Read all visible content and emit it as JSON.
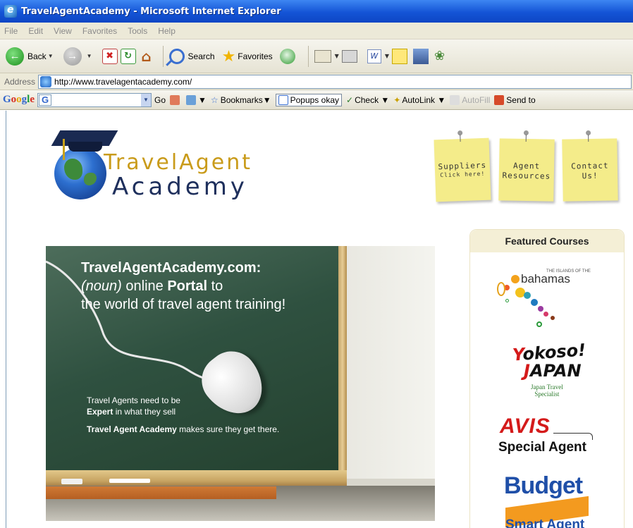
{
  "window": {
    "title": "TravelAgentAcademy - Microsoft Internet Explorer"
  },
  "menu": [
    "File",
    "Edit",
    "View",
    "Favorites",
    "Tools",
    "Help"
  ],
  "toolbar": {
    "back_label": "Back",
    "search_label": "Search",
    "favorites_label": "Favorites"
  },
  "address": {
    "label": "Address",
    "url": "http://www.travelagentacademy.com/"
  },
  "google_toolbar": {
    "logo": "Google",
    "go_label": "Go",
    "bookmarks_label": "Bookmarks",
    "popups_label": "Popups okay",
    "check_label": "Check",
    "autolink_label": "AutoLink",
    "autofill_label": "AutoFill",
    "sendto_label": "Send to"
  },
  "logo": {
    "line1": "TravelAgent",
    "line2": "Academy"
  },
  "notes": [
    {
      "line1": "Suppliers",
      "line2": "Click here!"
    },
    {
      "line1": "Agent",
      "line2": "Resources"
    },
    {
      "line1": "Contact",
      "line2": "Us!"
    }
  ],
  "hero": {
    "title": "TravelAgentAcademy.com:",
    "line2_noun": "(noun)",
    "line2_rest": "online",
    "line2_bold": "Portal",
    "line2_end": "to",
    "line3": "the world of travel agent training!",
    "s1": "Travel Agents need to be",
    "s2_bold": "Expert",
    "s2_rest": "in what they sell",
    "s3_bold": "Travel Agent Academy",
    "s3_rest": "makes sure they get there."
  },
  "featured": {
    "heading": "Featured Courses",
    "bahamas": {
      "word": "bahamas",
      "tiny": "THE ISLANDS OF THE"
    },
    "yokoso": {
      "y1a": "Y",
      "y1b": "okoso!",
      "y2a": "J",
      "y2b": "APAN",
      "sub1": "Japan Travel",
      "sub2": "Specialist"
    },
    "avis": {
      "word": "AVIS",
      "sub": "Special Agent"
    },
    "budget": {
      "word": "Budget",
      "sub": "Smart Agent"
    }
  }
}
